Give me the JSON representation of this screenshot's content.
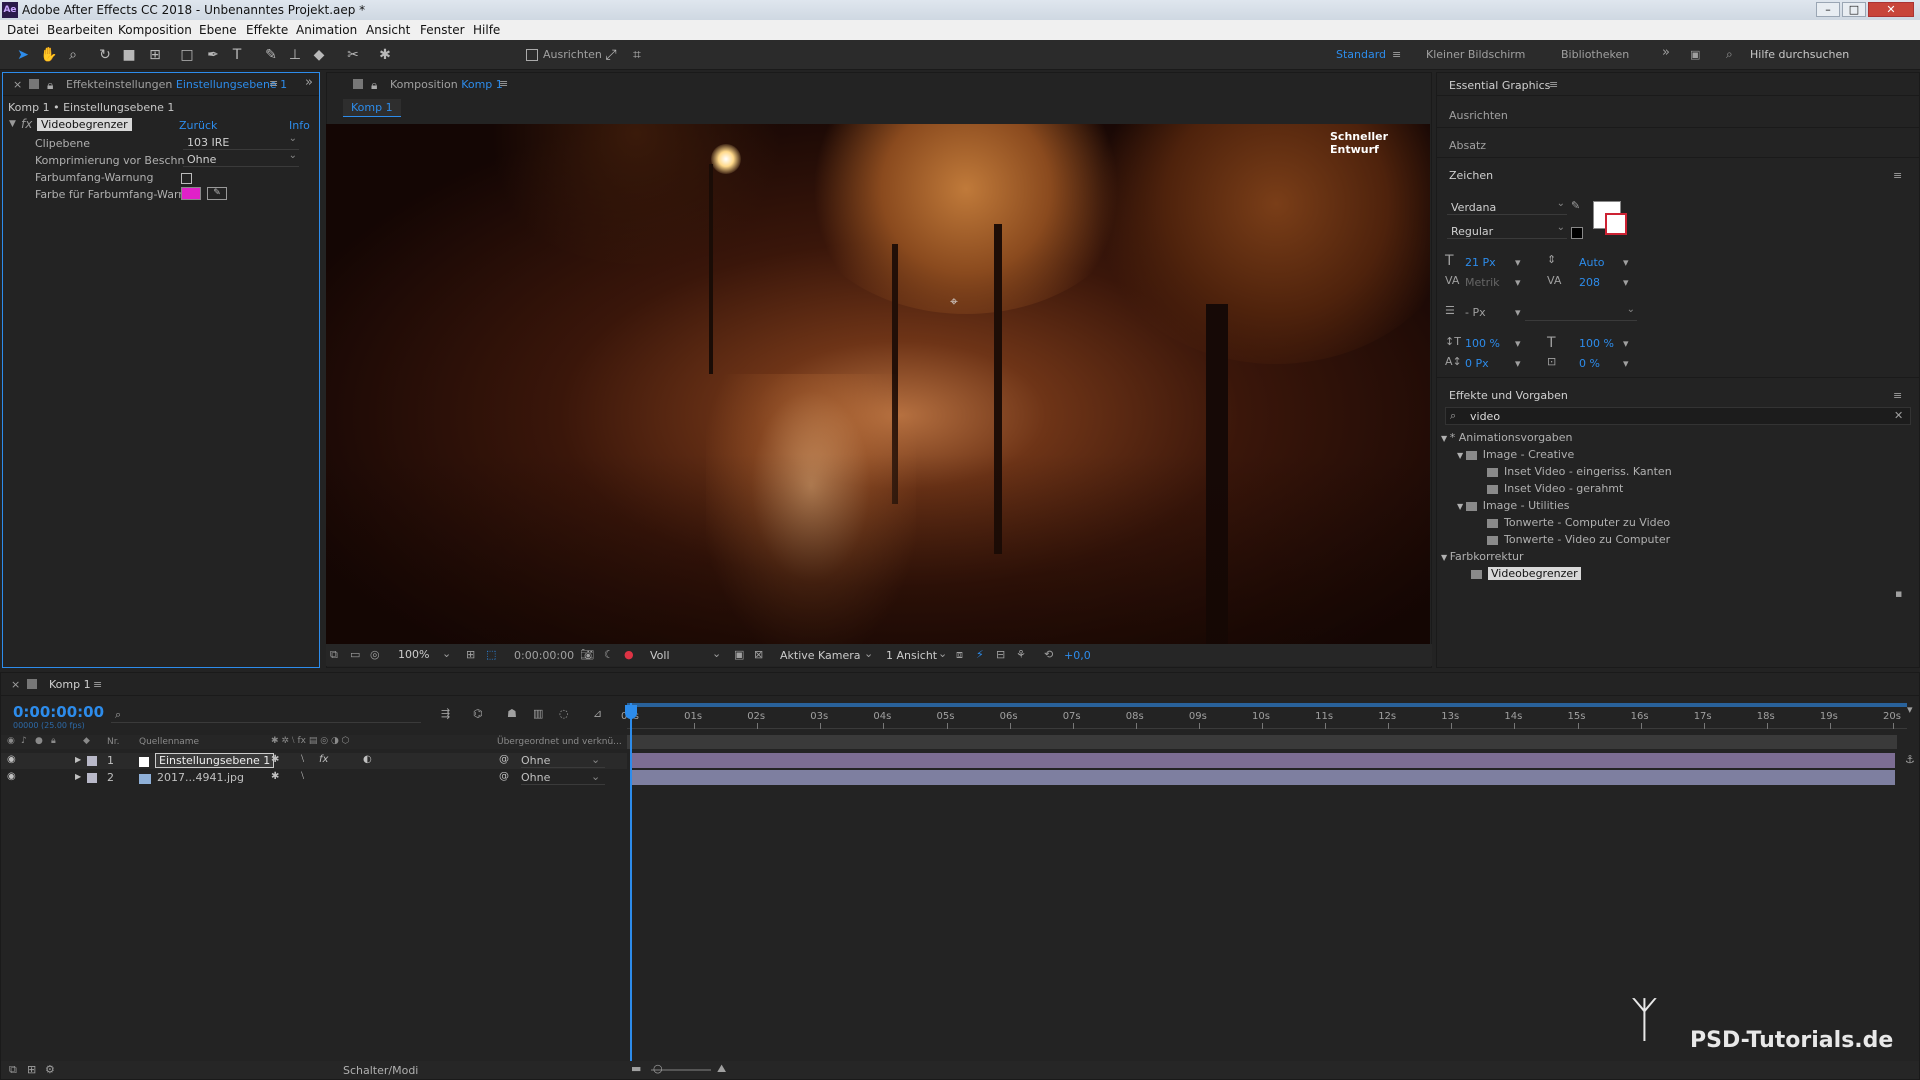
{
  "window": {
    "title": "Adobe After Effects CC 2018 - Unbenanntes Projekt.aep *",
    "logo": "Ae"
  },
  "menu": [
    "Datei",
    "Bearbeiten",
    "Komposition",
    "Ebene",
    "Effekte",
    "Animation",
    "Ansicht",
    "Fenster",
    "Hilfe"
  ],
  "toolbar": {
    "align_label": "Ausrichten",
    "workspaces": [
      "Standard",
      "Kleiner Bildschirm",
      "Bibliotheken"
    ],
    "search_placeholder": "Hilfe durchsuchen"
  },
  "effects_panel": {
    "tab_prefix": "Effekteinstellungen",
    "tab_layer": "Einstellungsebene 1",
    "breadcrumb": "Komp 1 • Einstellungsebene 1",
    "effect_name": "Videobegrenzer",
    "reset_label": "Zurück",
    "info_label": "Info",
    "props": [
      {
        "label": "Clipebene",
        "value": "103 IRE"
      },
      {
        "label": "Komprimierung vor Beschn",
        "value": "Ohne"
      },
      {
        "label": "Farbumfang-Warnung",
        "value": ""
      },
      {
        "label": "Farbe für Farbumfang-Warn",
        "value": ""
      }
    ],
    "warn_color": "#e020c8"
  },
  "composition": {
    "tab_prefix": "Komposition",
    "tab_name": "Komp 1",
    "subtab": "Komp 1",
    "draft_label": "Schneller Entwurf",
    "controls": {
      "zoom": "100%",
      "time": "0:00:00:00",
      "resolution": "Voll",
      "camera": "Aktive Kamera",
      "views": "1 Ansicht",
      "exposure": "+0,0"
    }
  },
  "right_panel": {
    "essential_graphics": "Essential Graphics",
    "ausrichten": "Ausrichten",
    "absatz": "Absatz",
    "zeichen": "Zeichen",
    "font": "Verdana",
    "style": "Regular",
    "size": "21 Px",
    "leading": "Auto",
    "kerning": "Metrik",
    "tracking": "208",
    "stroke": "- Px",
    "vscale": "100 %",
    "hscale": "100 %",
    "baseline": "0 Px",
    "tsume": "0 %",
    "effects_presets": "Effekte und Vorgaben",
    "search_value": "video",
    "tree": [
      {
        "label": "* Animationsvorgaben",
        "level": 0,
        "kind": "group"
      },
      {
        "label": "Image - Creative",
        "level": 1,
        "kind": "folder"
      },
      {
        "label": "Inset Video - eingeriss. Kanten",
        "level": 2,
        "kind": "preset"
      },
      {
        "label": "Inset Video - gerahmt",
        "level": 2,
        "kind": "preset"
      },
      {
        "label": "Image - Utilities",
        "level": 1,
        "kind": "folder"
      },
      {
        "label": "Tonwerte - Computer zu Video",
        "level": 2,
        "kind": "preset"
      },
      {
        "label": "Tonwerte - Video zu Computer",
        "level": 2,
        "kind": "preset"
      },
      {
        "label": "Farbkorrektur",
        "level": 0,
        "kind": "group"
      },
      {
        "label": "Videobegrenzer",
        "level": 1,
        "kind": "effect"
      }
    ]
  },
  "timeline": {
    "tab": "Komp 1",
    "timecode": "0:00:00:00",
    "frames": "00000 (25.00 fps)",
    "col_nr": "Nr.",
    "col_source": "Quellenname",
    "col_parent": "Übergeordnet und verknü...",
    "layers": [
      {
        "nr": "1",
        "name": "Einstellungsebene 1",
        "parent": "Ohne",
        "color": "#e8e8e8"
      },
      {
        "nr": "2",
        "name": "2017...4941.jpg",
        "parent": "Ohne",
        "color": "#8fb0d8"
      }
    ],
    "ruler": [
      "00s",
      "01s",
      "02s",
      "03s",
      "04s",
      "05s",
      "06s",
      "07s",
      "08s",
      "09s",
      "10s",
      "11s",
      "12s",
      "13s",
      "14s",
      "15s",
      "16s",
      "17s",
      "18s",
      "19s",
      "20s"
    ],
    "bottom_label": "Schalter/Modi"
  },
  "watermark": "PSD-Tutorials.de"
}
